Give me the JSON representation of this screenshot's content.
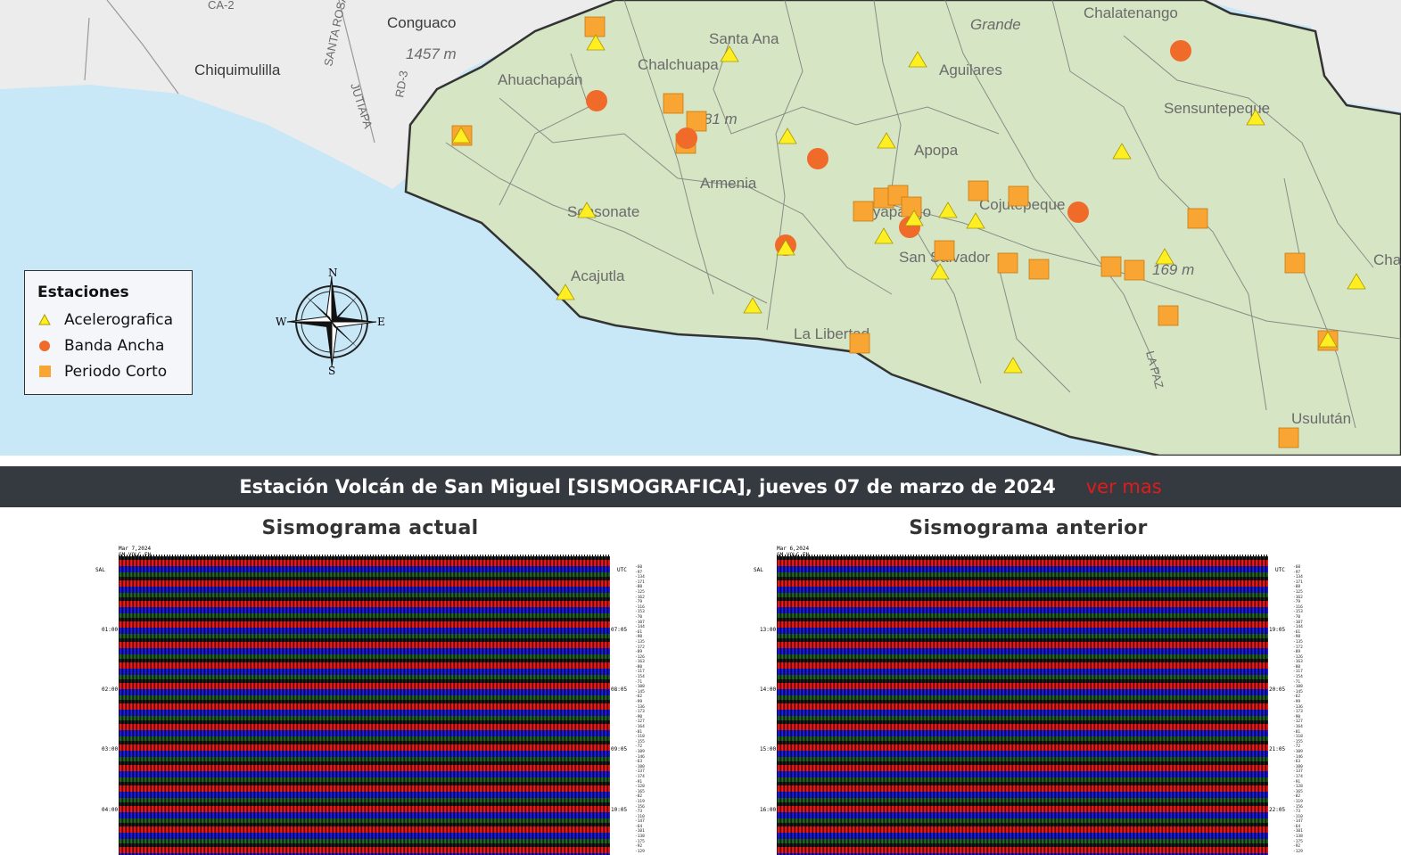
{
  "map": {
    "labels": {
      "conguaco": "Conguaco",
      "chiquimulilla": "Chiquimulilla",
      "elev1457": "1457 m",
      "ahuachapan": "Ahuachapán",
      "chalchuapa": "Chalchuapa",
      "santa_ana": "Santa Ana",
      "elev2381": "2381 m",
      "armenia": "Armenia",
      "sonsonate": "Sonsonate",
      "acajutla": "Acajutla",
      "aguilares": "Aguilares",
      "apopa": "Apopa",
      "soyapango": "Soyapango",
      "san_salvador": "San Salvador",
      "cojutepeque": "Cojutepeque",
      "la_libertad": "La Libertad",
      "chalatenango": "Chalatenango",
      "sensuntepeque": "Sensuntepeque",
      "usulutan": "Usulután",
      "la_paz": "LA PAZ",
      "santa_rosa": "SANTA ROSA",
      "jutiapa": "JUTIAPA",
      "ca2": "CA-2",
      "rd3": "RD-3",
      "cha": "Cha",
      "grande": "Grande",
      "elev169": "169 m"
    },
    "colors": {
      "land": "#d6e5c4",
      "water": "#c8e7f7",
      "acelerografica": "#ffee22",
      "banda_ancha": "#f06a2a",
      "periodo_corto": "#f8a534"
    }
  },
  "legend": {
    "title": "Estaciones",
    "items": [
      {
        "label": "Acelerografica",
        "symbol": "triangle"
      },
      {
        "label": "Banda Ancha",
        "symbol": "circle"
      },
      {
        "label": "Periodo Corto",
        "symbol": "square"
      }
    ]
  },
  "compass": {
    "n": "N",
    "s": "S",
    "e": "E",
    "w": "W"
  },
  "station_bar": {
    "title": "Estación Volcán de San Miguel [SISMOGRAFICA], jueves 07 de marzo de 2024",
    "link": "ver mas"
  },
  "panels": [
    {
      "title": "Sismograma actual",
      "header": "Mar 7,2024\nSM VOLC FN",
      "station": "SAL",
      "utc": "UTC",
      "left_times": [
        "01:00",
        "02:00",
        "03:00",
        "04:00"
      ],
      "right_times": [
        "07:05",
        "08:05",
        "09:05",
        "10:05"
      ]
    },
    {
      "title": "Sismograma anterior",
      "header": "Mar 6,2024\nSM VOLC FN",
      "station": "SAL",
      "utc": "UTC",
      "left_times": [
        "13:00",
        "14:00",
        "15:00",
        "16:00"
      ],
      "right_times": [
        "19:05",
        "20:05",
        "21:05",
        "22:05"
      ]
    }
  ]
}
